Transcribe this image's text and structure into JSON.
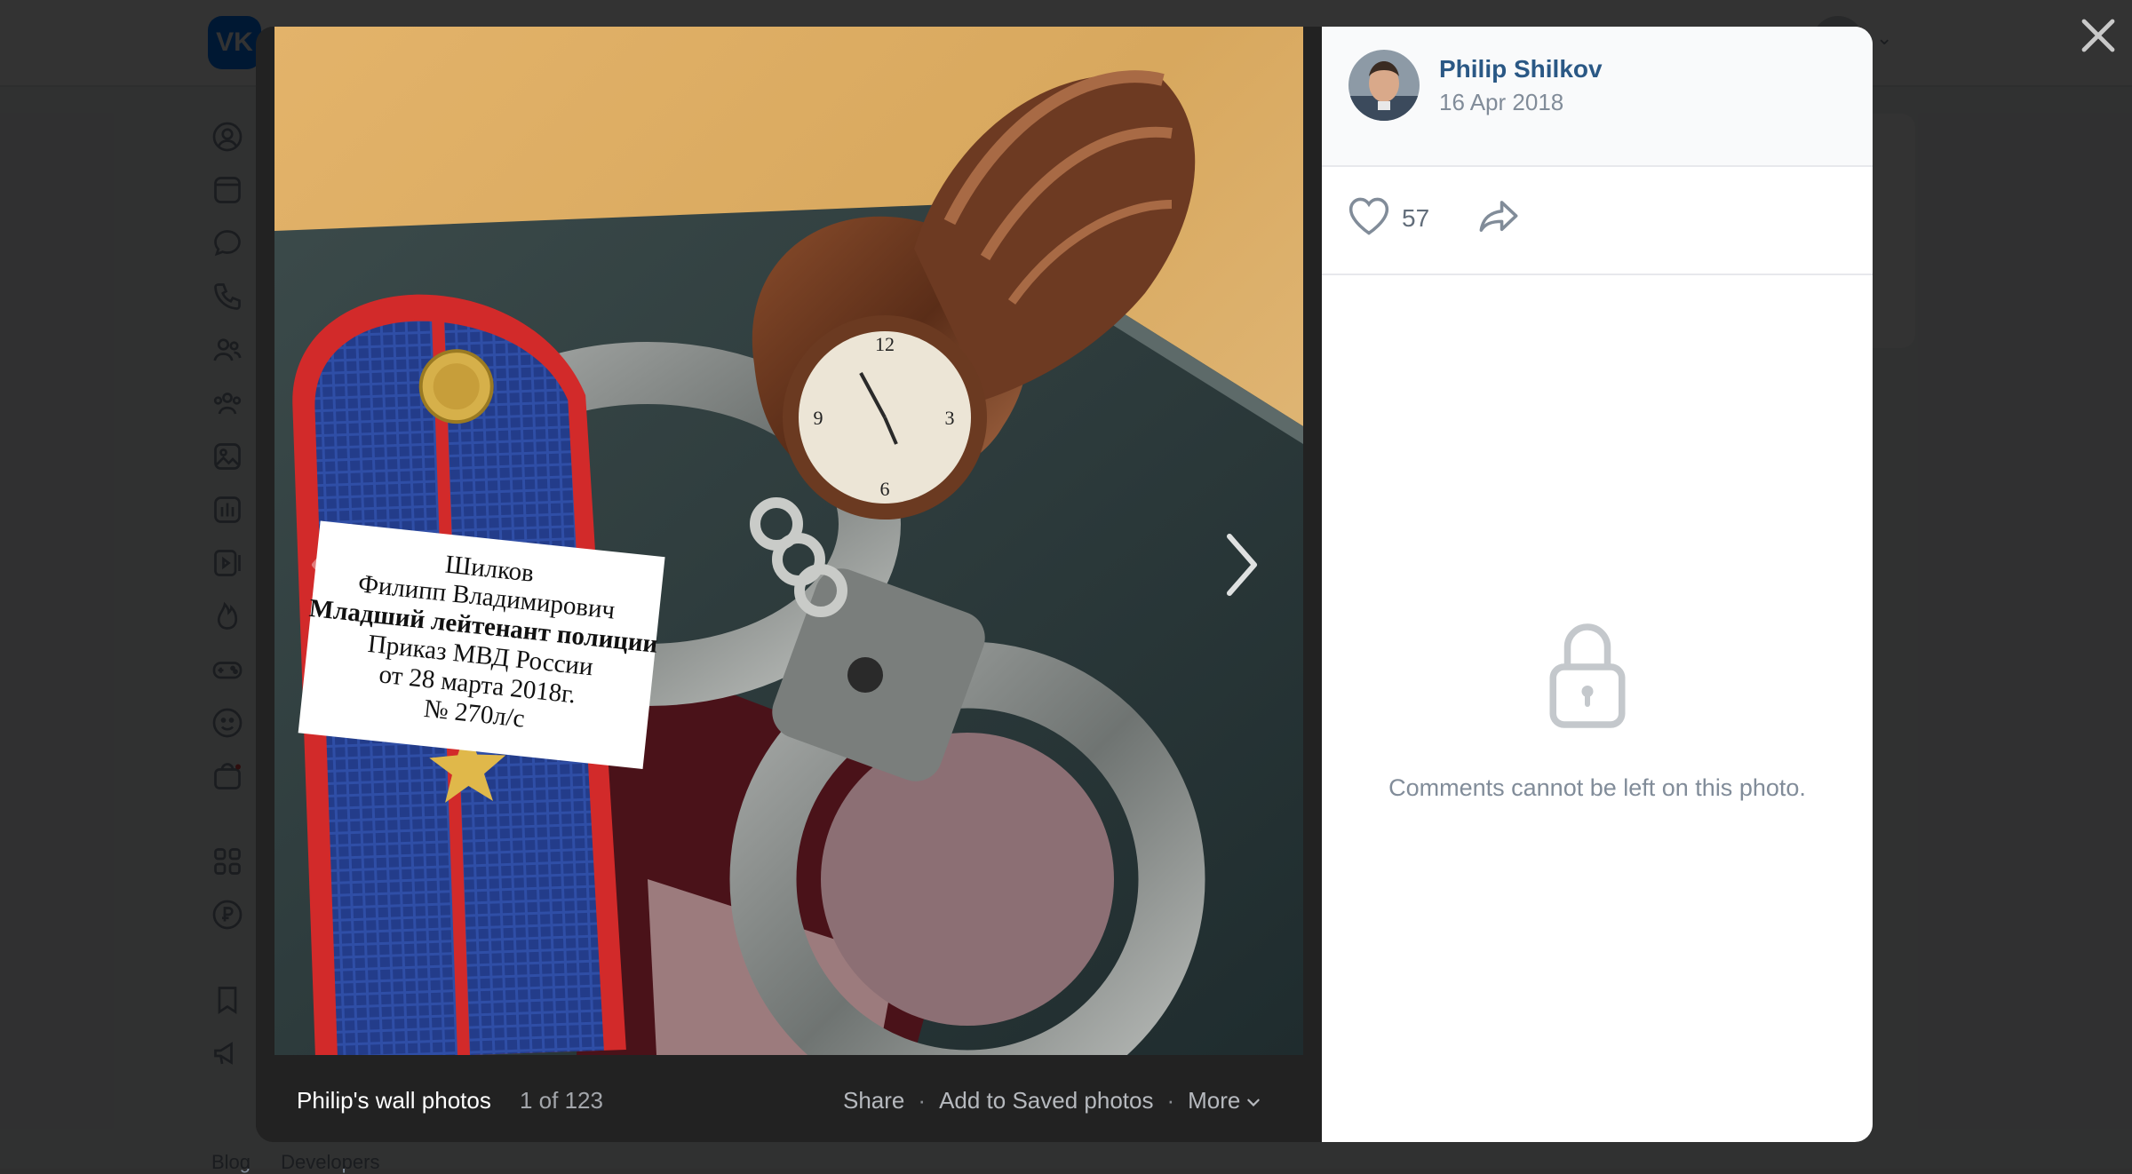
{
  "photo_viewer": {
    "author": "Philip Shilkov",
    "date": "16 Apr 2018",
    "likes": "57",
    "album_title": "Philip's wall photos",
    "counter": "1 of 123",
    "actions": {
      "share": "Share",
      "save": "Add to Saved photos",
      "more": "More"
    },
    "comments_notice": "Comments cannot be left on this photo."
  },
  "photo_text": {
    "line1": "Шилков",
    "line2": "Филипп Владимирович",
    "line3": "Младший лейтенант полиции",
    "line4": "Приказ МВД России",
    "line5": "от 28 марта 2018г.",
    "line6": "№ 270л/с"
  },
  "background_page": {
    "logo": "VK",
    "footer_links": [
      "Blog",
      "Developers"
    ]
  },
  "colors": {
    "link": "#2a5885",
    "accent": "#0077ff",
    "muted": "#818c99"
  },
  "icons": {
    "like": "heart-icon",
    "share": "share-arrow-icon",
    "lock": "lock-icon",
    "close": "close-icon",
    "prev": "chevron-left-icon",
    "next": "chevron-right-icon",
    "more": "chevron-down-icon"
  }
}
